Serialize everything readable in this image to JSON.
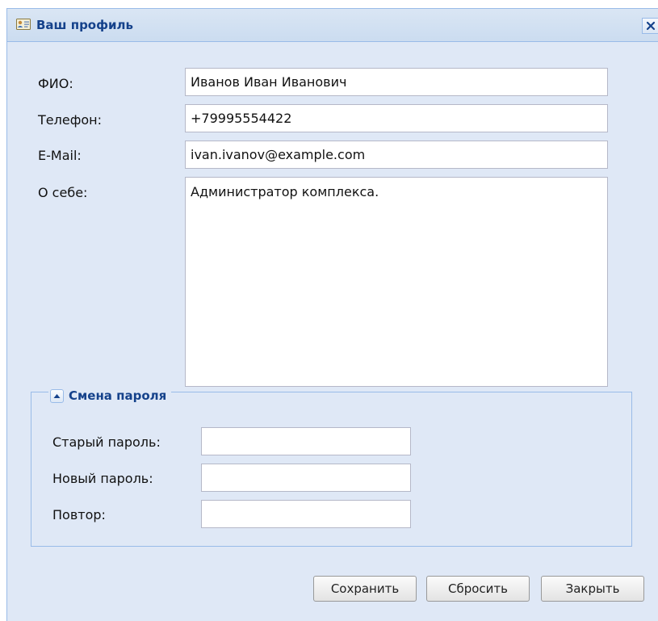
{
  "window": {
    "title": "Ваш профиль"
  },
  "form": {
    "fio": {
      "label": "ФИО:",
      "value": "Иванов Иван Иванович"
    },
    "phone": {
      "label": "Телефон:",
      "value": "+79995554422"
    },
    "email": {
      "label": "E-Mail:",
      "value": "ivan.ivanov@example.com"
    },
    "about": {
      "label": "О себе:",
      "value": "Администратор комплекса."
    }
  },
  "password_section": {
    "title": "Смена пароля",
    "old_label": "Старый пароль:",
    "new_label": "Новый пароль:",
    "repeat_label": "Повтор:",
    "old_value": "",
    "new_value": "",
    "repeat_value": ""
  },
  "buttons": {
    "save": "Сохранить",
    "reset": "Сбросить",
    "close": "Закрыть"
  },
  "colors": {
    "title_text": "#15428b",
    "window_bg": "#dfe8f6",
    "border": "#99bbe8"
  }
}
